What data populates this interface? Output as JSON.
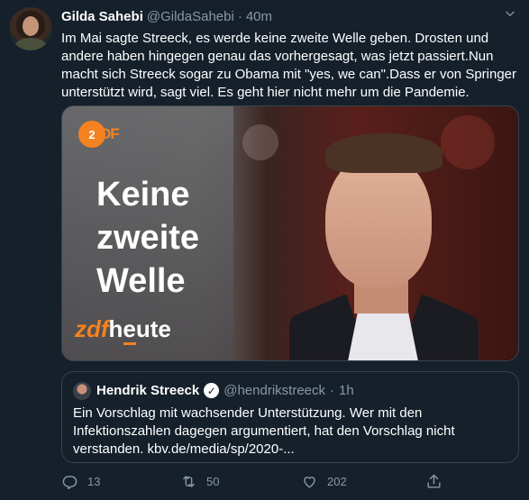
{
  "tweet": {
    "author_name": "Gilda Sahebi",
    "handle": "@GildaSahebi",
    "separator": "·",
    "time": "40m",
    "text": "Im Mai sagte Streeck, es werde keine zweite Welle geben. Drosten und andere haben hingegen genau das vorhergesagt, was jetzt passiert.Nun macht sich Streeck sogar zu Obama mit \"yes, we can\".Dass er von Springer unterstützt wird, sagt viel. Es geht hier nicht mehr um die Pandemie."
  },
  "media": {
    "logo_circle": "2",
    "logo_rest": "DF",
    "headline_line1": "Keine",
    "headline_line2": "zweite",
    "headline_line3": "Welle",
    "brand_zdf": "zdf",
    "brand_heute": "heute"
  },
  "quoted": {
    "author_name": "Hendrik Streeck",
    "verified_icon": "✓",
    "handle": "@hendrikstreeck",
    "separator": "·",
    "time": "1h",
    "text": "Ein Vorschlag mit wachsender Unterstützung.  Wer mit den Infektionszahlen dagegen argumentiert, hat den Vorschlag nicht verstanden. kbv.de/media/sp/2020-..."
  },
  "actions": {
    "reply_count": "13",
    "retweet_count": "50",
    "like_count": "202"
  },
  "colors": {
    "background": "#15202b",
    "secondary_text": "#8899a6",
    "border": "#38444d",
    "zdf_orange": "#f58220"
  },
  "icons": {
    "reply": "reply-icon",
    "retweet": "retweet-icon",
    "like": "heart-icon",
    "share": "share-icon",
    "menu": "chevron-down-icon"
  }
}
